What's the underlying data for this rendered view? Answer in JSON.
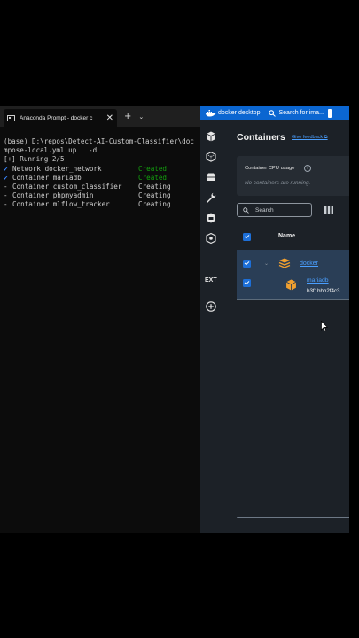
{
  "terminal": {
    "tab_title": "Anaconda Prompt - docker  c",
    "tab_close": "✕",
    "add_tab": "+",
    "dropdown": "⌄",
    "lines": [
      "(base) D:\\repos\\Detect-AI-Custom-Classifier\\doc",
      "mpose-local.yml up   -d",
      "[+] Running 2/5"
    ],
    "services": [
      {
        "mark": "✔",
        "name": "Network docker_network",
        "status": "Created"
      },
      {
        "mark": "✔",
        "name": "Container mariadb",
        "status": "Created"
      },
      {
        "mark": "-",
        "name": "Container custom_classifier",
        "status": "Creating"
      },
      {
        "mark": "-",
        "name": "Container phpmyadmin",
        "status": "Creating"
      },
      {
        "mark": "-",
        "name": "Container mlflow_tracker",
        "status": "Creating"
      }
    ]
  },
  "docker": {
    "brand": "docker desktop",
    "search_text": "Search for ima...",
    "rail_ext": "EXT",
    "title": "Containers",
    "feedback": "Give feedback ⧉",
    "cpu_label": "Container CPU usage",
    "info_icon": "i",
    "cpu_empty": "No containers are running.",
    "search_placeholder": "Search",
    "col_name": "Name",
    "chevron": "⌄",
    "group_name": "docker",
    "container_name": "mariadb",
    "container_id": "b3f1bbb2f4c3"
  },
  "colors": {
    "accent": "#1d6fd8",
    "header": "#0b66d1",
    "created": "#13a10e",
    "link": "#4a9fff",
    "icon_orange": "#f0a030"
  }
}
